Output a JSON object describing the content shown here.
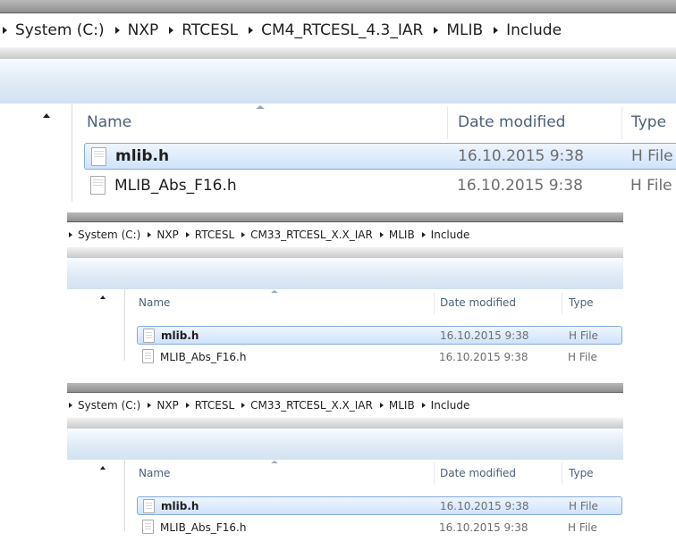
{
  "panels": [
    {
      "breadcrumb": [
        "System (C:)",
        "NXP",
        "RTCESL",
        "CM4_RTCESL_4.3_IAR",
        "MLIB",
        "Include"
      ],
      "columns": {
        "name": "Name",
        "date": "Date modified",
        "type": "Type"
      },
      "files": [
        {
          "name": "mlib.h",
          "date": "16.10.2015 9:38",
          "type": "H File",
          "selected": true
        },
        {
          "name": "MLIB_Abs_F16.h",
          "date": "16.10.2015 9:38",
          "type": "H File",
          "selected": false
        }
      ]
    },
    {
      "breadcrumb": [
        "System (C:)",
        "NXP",
        "RTCESL",
        "CM33_RTCESL_X.X_IAR",
        "MLIB",
        "Include"
      ],
      "columns": {
        "name": "Name",
        "date": "Date modified",
        "type": "Type"
      },
      "files": [
        {
          "name": "mlib.h",
          "date": "16.10.2015 9:38",
          "type": "H File",
          "selected": true
        },
        {
          "name": "MLIB_Abs_F16.h",
          "date": "16.10.2015 9:38",
          "type": "H File",
          "selected": false
        }
      ]
    },
    {
      "breadcrumb": [
        "System (C:)",
        "NXP",
        "RTCESL",
        "CM33_RTCESL_X.X_IAR",
        "MLIB",
        "Include"
      ],
      "columns": {
        "name": "Name",
        "date": "Date modified",
        "type": "Type"
      },
      "files": [
        {
          "name": "mlib.h",
          "date": "16.10.2015 9:38",
          "type": "H File",
          "selected": true
        },
        {
          "name": "MLIB_Abs_F16.h",
          "date": "16.10.2015 9:38",
          "type": "H File",
          "selected": false
        }
      ]
    }
  ]
}
